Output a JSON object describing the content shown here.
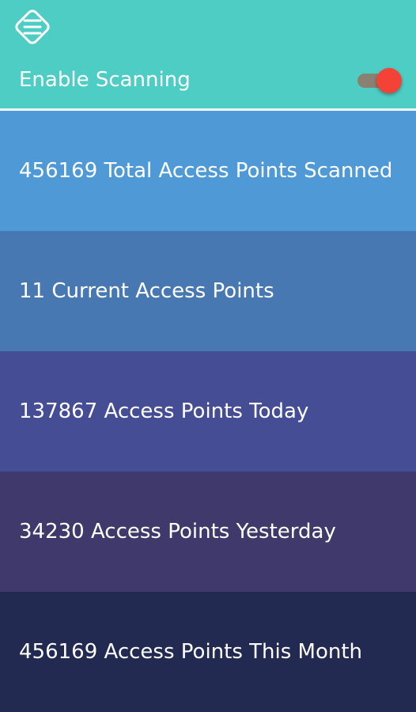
{
  "header": {
    "scan_label": "Enable Scanning",
    "scanning_enabled": true,
    "menu_icon": "menu-hamburger-icon",
    "colors": {
      "background": "#4ecdc4",
      "toggle_thumb": "#f44336",
      "toggle_track": "#8a8172"
    }
  },
  "stats": [
    {
      "text": "456169 Total Access Points Scanned",
      "color": "#4f9ad6"
    },
    {
      "text": "11 Current Access Points",
      "color": "#4878b2"
    },
    {
      "text": "137867 Access Points Today",
      "color": "#454d94"
    },
    {
      "text": "34230 Access Points Yesterday",
      "color": "#3f3a6b"
    },
    {
      "text": "456169 Access Points This Month",
      "color": "#222a52"
    }
  ]
}
